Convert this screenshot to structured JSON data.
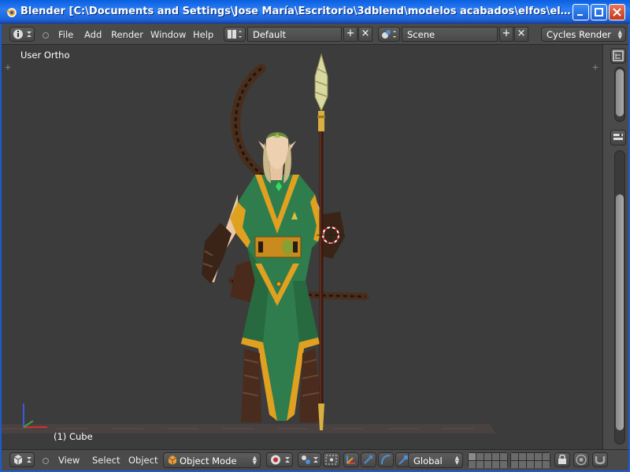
{
  "window": {
    "title": "Blender [C:\\Documents and Settings\\Jose María\\Escritorio\\3dblend\\modelos acabados\\elfos\\elfos solares\\textu..."
  },
  "top_header": {
    "menus": [
      "File",
      "Add",
      "Render",
      "Window",
      "Help"
    ],
    "screen_layout": "Default",
    "scene": "Scene",
    "render_engine": "Cycles Render"
  },
  "viewport": {
    "view_label": "User Ortho",
    "object_label": "(1) Cube"
  },
  "bottom_header": {
    "menus": [
      "View",
      "Select",
      "Object"
    ],
    "mode": "Object Mode",
    "orientation": "Global"
  },
  "colors": {
    "xp_titlebar": "#0a5fe0",
    "blender_header": "#4a4a4a",
    "viewport_bg": "#3c3c3c",
    "robe_green": "#2e7a4a",
    "robe_trim": "#e0a020"
  },
  "icons": {
    "info": "info-icon",
    "screen_layout": "layout-icon",
    "scene": "scene-icon",
    "cube": "cube-icon",
    "cursor": "3d-cursor-icon"
  }
}
